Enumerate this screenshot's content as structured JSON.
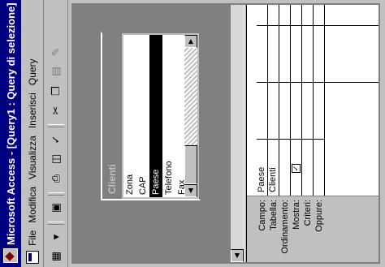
{
  "window": {
    "title": "Microsoft Access - [Query1 : Query di selezione]"
  },
  "menu": {
    "items": [
      {
        "label": "File"
      },
      {
        "label": "Modifica"
      },
      {
        "label": "Visualizza"
      },
      {
        "label": "Inserisci"
      },
      {
        "label": "Query"
      }
    ]
  },
  "field_list": {
    "title": "Clienti",
    "fields": [
      "Zona",
      "CAP",
      "Paese",
      "Telefono",
      "Fax"
    ],
    "selected": "Paese"
  },
  "grid": {
    "row_labels": [
      "Campo:",
      "Tabella:",
      "Ordinamento:",
      "Mostra:",
      "Criteri:",
      "Oppure:"
    ],
    "column1": {
      "campo": "Paese",
      "tabella": "Clienti",
      "mostra_checked": true
    }
  },
  "icons": {
    "app": "access-key-icon",
    "menu_doc": "document-icon",
    "checkmark": "✓"
  }
}
